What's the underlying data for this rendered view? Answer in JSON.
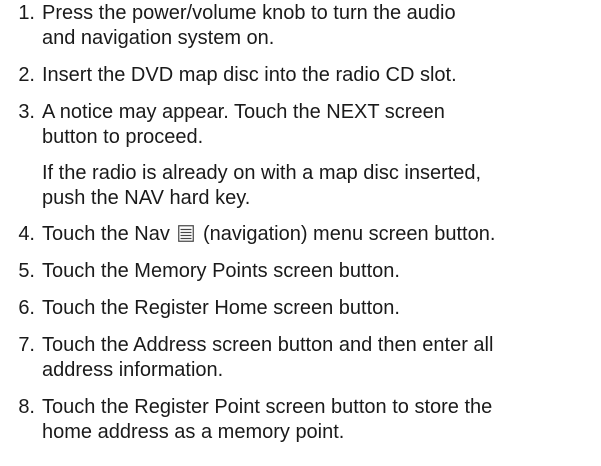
{
  "steps": [
    {
      "number": "1.",
      "lines": [
        "Press the power/volume knob to turn the audio",
        "and navigation system on."
      ]
    },
    {
      "number": "2.",
      "lines": [
        "Insert the DVD map disc into the radio CD slot."
      ]
    },
    {
      "number": "3.",
      "lines": [
        "A notice may appear. Touch the NEXT screen",
        "button to proceed."
      ]
    },
    {
      "note_lines": [
        "If the radio is already on with a map disc inserted,",
        "push the NAV hard key."
      ]
    },
    {
      "number": "4.",
      "before_icon": "Touch the Nav",
      "icon": "navigation-menu-icon",
      "after_icon": "(navigation) menu screen button."
    },
    {
      "number": "5.",
      "lines": [
        "Touch the Memory Points screen button."
      ]
    },
    {
      "number": "6.",
      "lines": [
        "Touch the Register Home screen button."
      ]
    },
    {
      "number": "7.",
      "lines": [
        "Touch the Address screen button and then enter all",
        "address information."
      ]
    },
    {
      "number": "8.",
      "lines": [
        "Touch the Register Point screen button to store the",
        "home address as a memory point."
      ]
    }
  ]
}
